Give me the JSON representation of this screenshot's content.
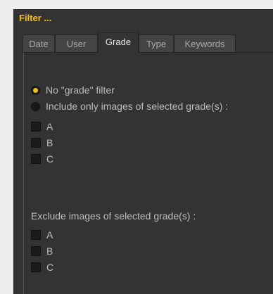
{
  "panel": {
    "title": "Filter ..."
  },
  "tabs": [
    {
      "label": "Date"
    },
    {
      "label": "User"
    },
    {
      "label": "Grade",
      "active": true
    },
    {
      "label": "Type"
    },
    {
      "label": "Keywords"
    }
  ],
  "grade_filter": {
    "options": [
      {
        "label": "No \"grade\" filter",
        "selected": true
      },
      {
        "label": "Include only images of selected grade(s) :",
        "selected": false
      }
    ],
    "include_grades": [
      {
        "label": "A",
        "checked": false
      },
      {
        "label": "B",
        "checked": false
      },
      {
        "label": "C",
        "checked": false
      }
    ],
    "exclude_label": "Exclude images of selected grade(s) :",
    "exclude_grades": [
      {
        "label": "A",
        "checked": false
      },
      {
        "label": "B",
        "checked": false
      },
      {
        "label": "C",
        "checked": false
      }
    ]
  },
  "colors": {
    "accent": "#f2c200",
    "panel_bg": "#333333",
    "text": "#bdbdbd"
  }
}
